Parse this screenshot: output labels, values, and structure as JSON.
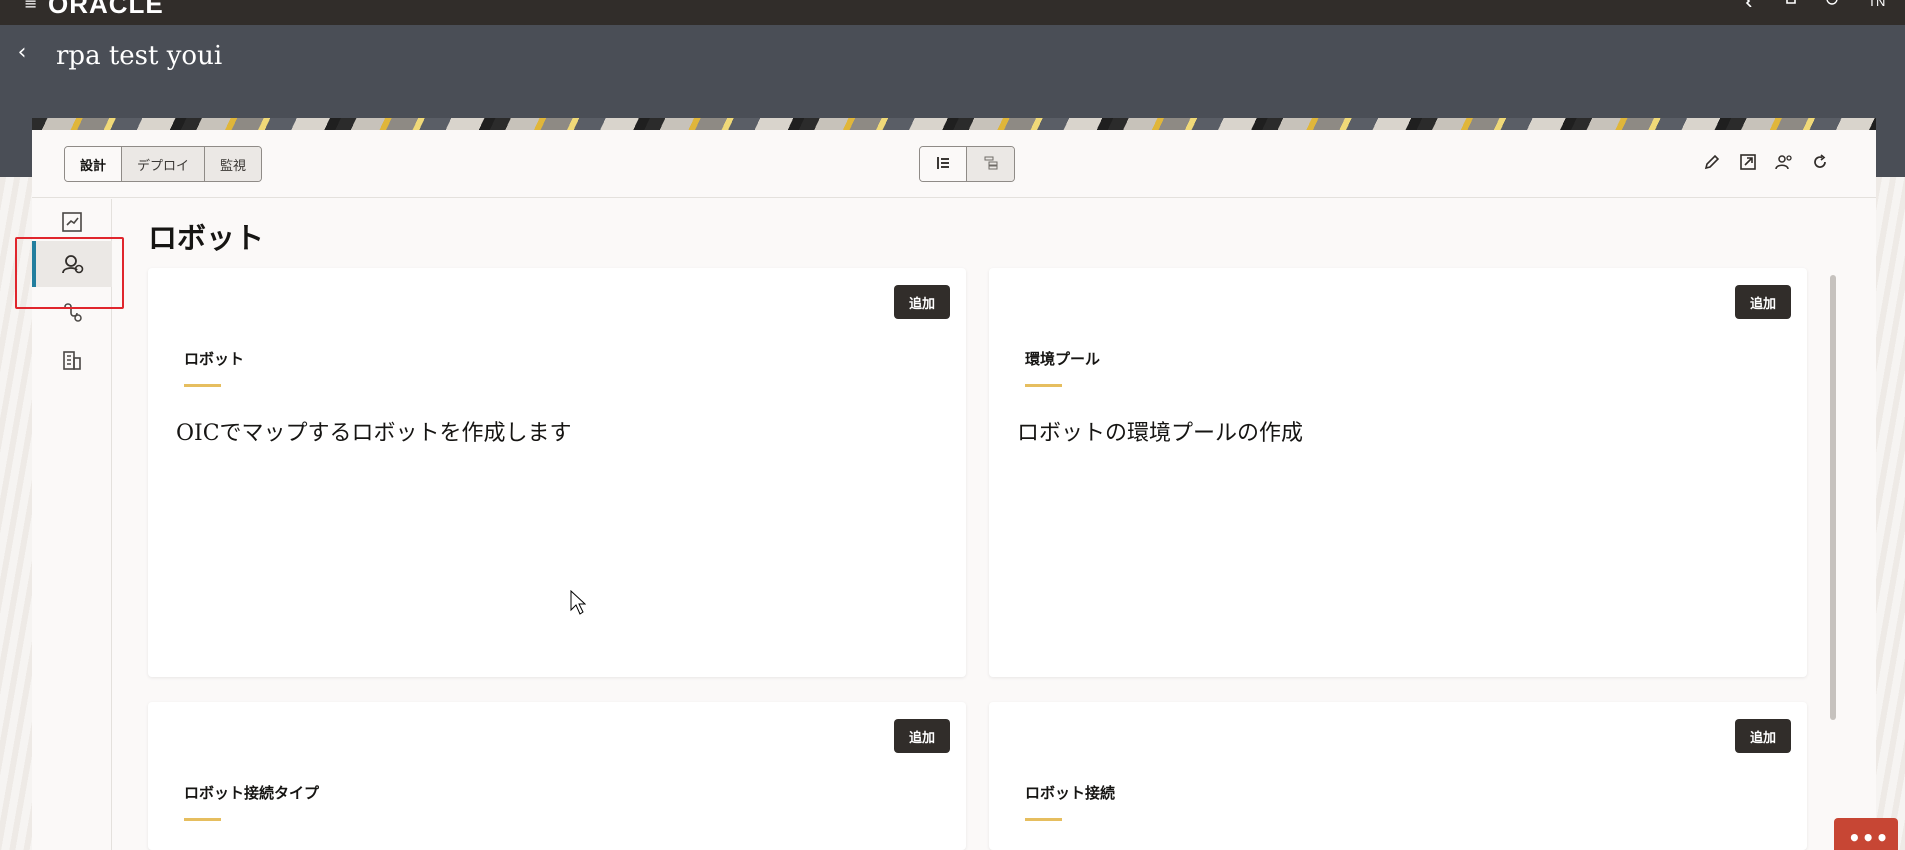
{
  "topbar": {
    "logo_text": "ORACLE",
    "user_initials": "TN"
  },
  "header": {
    "title": "rpa test youi"
  },
  "mode_tabs": [
    {
      "label": "設計",
      "active": true
    },
    {
      "label": "デプロイ",
      "active": false
    },
    {
      "label": "監視",
      "active": false
    }
  ],
  "page": {
    "title": "ロボット"
  },
  "cards": [
    {
      "title": "ロボット",
      "description": "OICでマップするロボットを作成します",
      "add_label": "追加"
    },
    {
      "title": "環境プール",
      "description": "ロボットの環境プールの作成",
      "add_label": "追加"
    },
    {
      "title": "ロボット接続タイプ",
      "description": "",
      "add_label": "追加"
    },
    {
      "title": "ロボット接続",
      "description": "",
      "add_label": "追加"
    }
  ],
  "icons": {
    "topbar": [
      "hamburger-menu-icon",
      "phone-icon",
      "bell-icon",
      "help-icon"
    ],
    "toolbar": [
      "pencil-icon",
      "export-icon",
      "people-icon",
      "refresh-icon"
    ],
    "rail": [
      "integration-icon",
      "robot-icon",
      "connection-icon",
      "building-icon"
    ]
  },
  "colors": {
    "accent_gold": "#e6be5f",
    "active_rail": "#227e9e",
    "highlight_red": "#e0262d",
    "header_bg": "#4a4e56",
    "topbar_bg": "#312d2a"
  }
}
